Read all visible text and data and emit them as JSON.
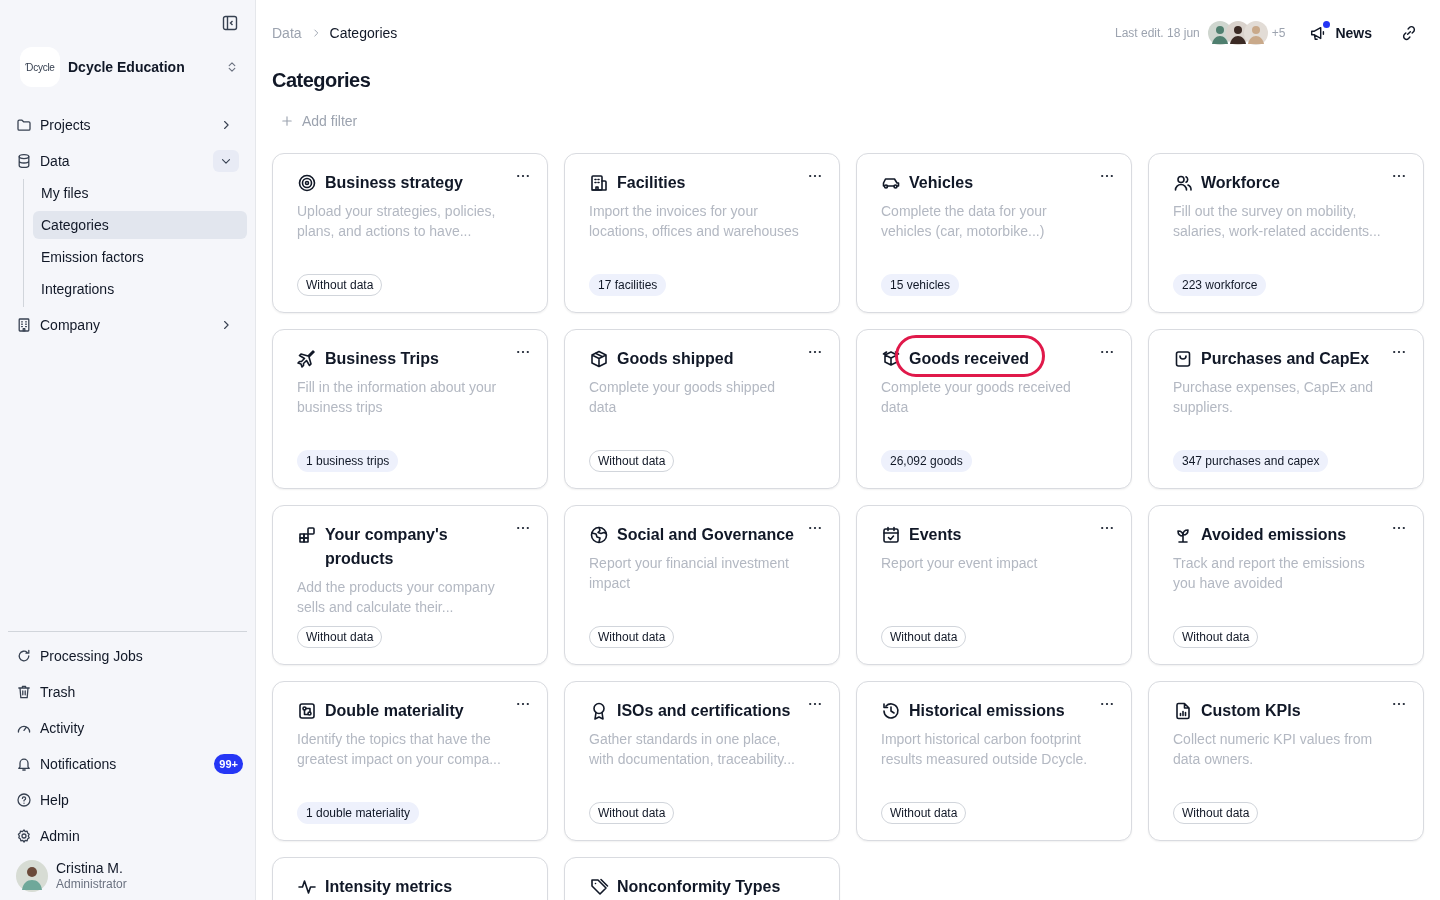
{
  "sidebar": {
    "org": {
      "logo": "Ɗcycle",
      "name": "Dcycle Education"
    },
    "items": [
      {
        "label": "Projects",
        "expanded": false
      },
      {
        "label": "Data",
        "expanded": true,
        "children": [
          {
            "label": "My files",
            "selected": false
          },
          {
            "label": "Categories",
            "selected": true
          },
          {
            "label": "Emission factors",
            "selected": false
          },
          {
            "label": "Integrations",
            "selected": false
          }
        ]
      },
      {
        "label": "Company",
        "expanded": false
      }
    ],
    "bottom_items": [
      {
        "label": "Processing Jobs"
      },
      {
        "label": "Trash"
      },
      {
        "label": "Activity"
      },
      {
        "label": "Notifications",
        "badge": "99+"
      },
      {
        "label": "Help"
      },
      {
        "label": "Admin"
      }
    ],
    "user": {
      "name": "Cristina M.",
      "role": "Administrator"
    }
  },
  "header": {
    "breadcrumb": [
      "Data",
      "Categories"
    ],
    "last_edit": "Last edit. 18 jun",
    "more_editors": "+5",
    "news": "News",
    "news_unread": true
  },
  "title": "Categories",
  "add_filter": "Add filter",
  "cards": [
    {
      "title": "Business strategy",
      "description": "Upload your strategies, policies, plans, and actions to have...",
      "badge": "Without data",
      "kind": "empty",
      "highlighted": false
    },
    {
      "title": "Facilities",
      "description": "Import the invoices for your locations, offices and warehouses",
      "badge": "17 facilities",
      "kind": "count",
      "highlighted": false
    },
    {
      "title": "Vehicles",
      "description": "Complete the data for your vehicles (car, motorbike...)",
      "badge": "15 vehicles",
      "kind": "count",
      "highlighted": false
    },
    {
      "title": "Workforce",
      "description": "Fill out the survey on mobility, salaries, work-related accidents...",
      "badge": "223 workforce",
      "kind": "count",
      "highlighted": false
    },
    {
      "title": "Business Trips",
      "description": "Fill in the information about your business trips",
      "badge": "1 business trips",
      "kind": "count",
      "highlighted": false
    },
    {
      "title": "Goods shipped",
      "description": "Complete your goods shipped data",
      "badge": "Without data",
      "kind": "empty",
      "highlighted": false
    },
    {
      "title": "Goods received",
      "description": "Complete your goods received data",
      "badge": "26,092 goods",
      "kind": "count",
      "highlighted": true
    },
    {
      "title": "Purchases and CapEx",
      "description": "Purchase expenses, CapEx and suppliers.",
      "badge": "347 purchases and capex",
      "kind": "count",
      "highlighted": false
    },
    {
      "title": "Your company's products",
      "description": "Add the products your company sells and calculate their...",
      "badge": "Without data",
      "kind": "empty",
      "highlighted": false
    },
    {
      "title": "Social and Governance",
      "description": "Report your financial investment impact",
      "badge": "Without data",
      "kind": "empty",
      "highlighted": false
    },
    {
      "title": "Events",
      "description": "Report your event impact",
      "badge": "Without data",
      "kind": "empty",
      "highlighted": false
    },
    {
      "title": "Avoided emissions",
      "description": "Track and report the emissions you have avoided",
      "badge": "Without data",
      "kind": "empty",
      "highlighted": false
    },
    {
      "title": "Double materiality",
      "description": "Identify the topics that have the greatest impact on your compa...",
      "badge": "1 double materiality",
      "kind": "count",
      "highlighted": false
    },
    {
      "title": "ISOs and certifications",
      "description": "Gather standards in one place, with documentation, traceability...",
      "badge": "Without data",
      "kind": "empty",
      "highlighted": false
    },
    {
      "title": "Historical emissions",
      "description": "Import historical carbon footprint results measured outside Dcycle.",
      "badge": "Without data",
      "kind": "empty",
      "highlighted": false
    },
    {
      "title": "Custom KPIs",
      "description": "Collect numeric KPI values from data owners.",
      "badge": "Without data",
      "kind": "empty",
      "highlighted": false
    },
    {
      "title": "Intensity metrics",
      "kind": "partial",
      "highlighted": false
    },
    {
      "title": "Nonconformity Types",
      "kind": "partial",
      "highlighted": false
    }
  ]
}
